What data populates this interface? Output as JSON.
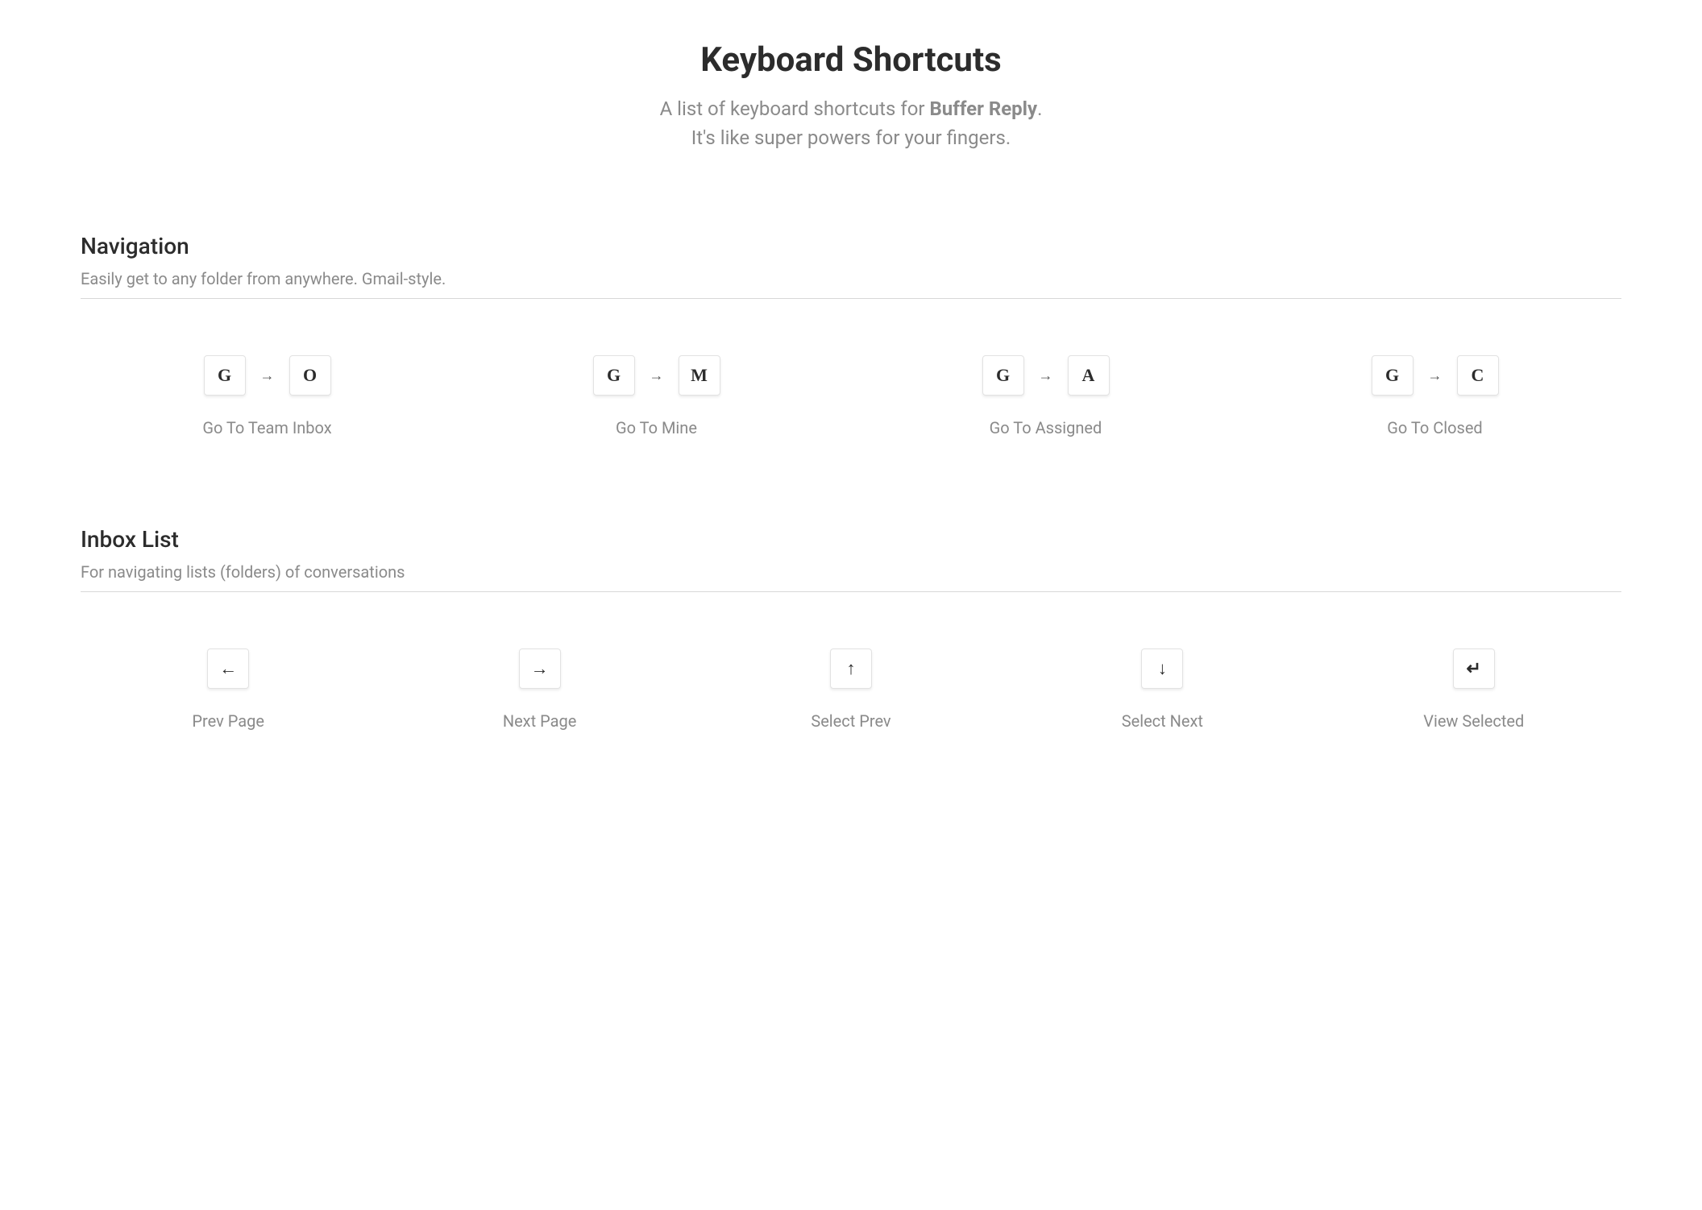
{
  "header": {
    "title": "Keyboard Shortcuts",
    "subtitle_prefix": "A list of keyboard shortcuts for ",
    "subtitle_strong": "Buffer Reply",
    "subtitle_suffix": ".",
    "subtitle_line2": "It's like super powers for your fingers."
  },
  "sections": [
    {
      "title": "Navigation",
      "description": "Easily get to any folder from anywhere. Gmail-style.",
      "shortcuts": [
        {
          "keys": [
            "G",
            "O"
          ],
          "sequence": true,
          "label": "Go To Team Inbox"
        },
        {
          "keys": [
            "G",
            "M"
          ],
          "sequence": true,
          "label": "Go To Mine"
        },
        {
          "keys": [
            "G",
            "A"
          ],
          "sequence": true,
          "label": "Go To Assigned"
        },
        {
          "keys": [
            "G",
            "C"
          ],
          "sequence": true,
          "label": "Go To Closed"
        }
      ]
    },
    {
      "title": "Inbox List",
      "description": "For navigating lists (folders) of conversations",
      "shortcuts": [
        {
          "keys": [
            "←"
          ],
          "symbol": true,
          "label": "Prev Page"
        },
        {
          "keys": [
            "→"
          ],
          "symbol": true,
          "label": "Next Page"
        },
        {
          "keys": [
            "↑"
          ],
          "symbol": true,
          "label": "Select Prev"
        },
        {
          "keys": [
            "↓"
          ],
          "symbol": true,
          "label": "Select Next"
        },
        {
          "keys": [
            "↵"
          ],
          "symbol": true,
          "label": "View Selected"
        }
      ]
    }
  ]
}
